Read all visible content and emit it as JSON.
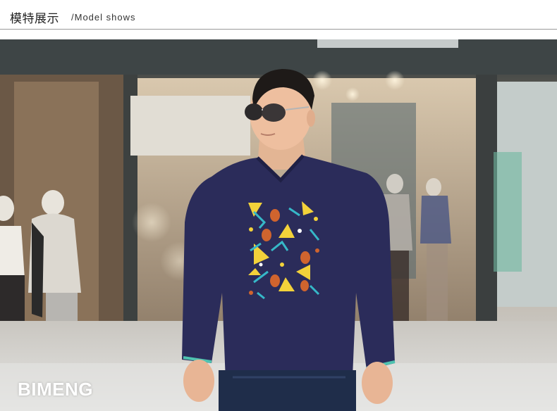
{
  "header": {
    "title": "模特展示",
    "subtitle": "/Model shows"
  },
  "photo": {
    "subject": "model-wearing-navy-long-sleeve-tee",
    "colors": {
      "shirt": "#2b2c5a",
      "cuff_trim": "#4fc3b0",
      "print_yellow": "#f3d23a",
      "print_teal": "#36b8c8",
      "print_orange": "#d0642e"
    }
  },
  "watermark": {
    "text": "BIMENG"
  }
}
